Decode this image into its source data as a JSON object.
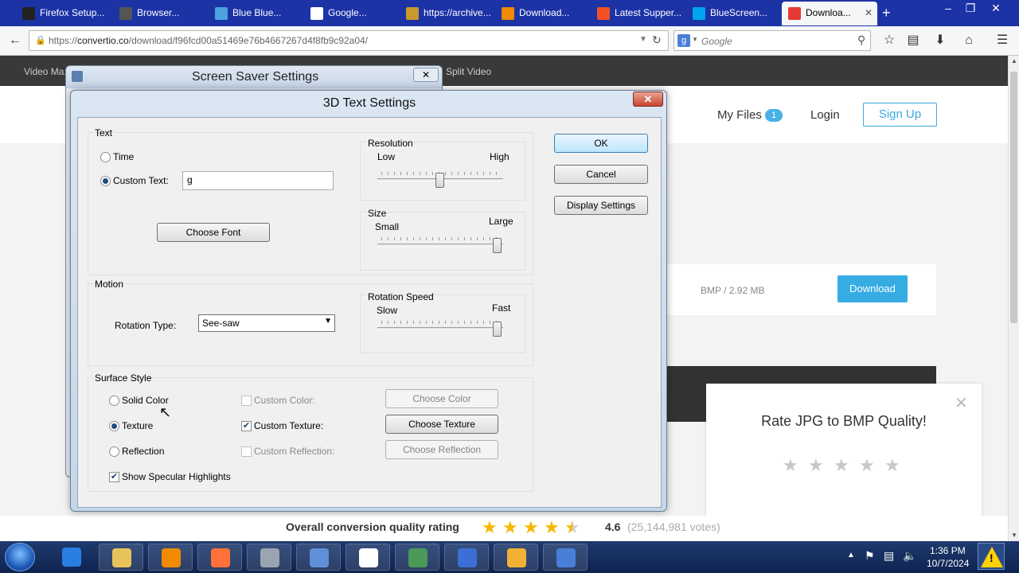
{
  "browser": {
    "tabs": [
      {
        "label": "Firefox Setup...",
        "icon": "film-icon",
        "color": "#222222"
      },
      {
        "label": "Browser...",
        "icon": "page-icon",
        "color": "#555555"
      },
      {
        "label": "Blue Blue...",
        "icon": "star-burst-icon",
        "color": "#4aa3df"
      },
      {
        "label": "Google...",
        "icon": "google-icon",
        "color": "#ffffff"
      },
      {
        "label": "https://archive...",
        "icon": "box-icon",
        "color": "#c79a2a"
      },
      {
        "label": "Download...",
        "icon": "vlc-cone-icon",
        "color": "#f08a00"
      },
      {
        "label": "Latest Supper...",
        "icon": "windows-flag-icon",
        "color": "#f25022"
      },
      {
        "label": "BlueScreen...",
        "icon": "windows-flag-icon",
        "color": "#00a4ef"
      },
      {
        "label": "Downloa...",
        "icon": "convertio-icon",
        "color": "#e53935",
        "active": true
      }
    ],
    "new_tab_symbol": "+",
    "url_prefix": "https://",
    "url_domain": "convertio.co",
    "url_path": "/download/f96fcd00a51469e76b4667267d4f8fb9c92a04/",
    "search_placeholder": "Google"
  },
  "site": {
    "nav_left": "Video Ma...",
    "nav_right": "Split Video",
    "my_files": "My Files",
    "my_files_count": "1",
    "login": "Login",
    "signup": "Sign Up",
    "file_meta": "BMP / 2.92 MB",
    "download": "Download",
    "rate_title": "Rate JPG to BMP Quality!",
    "rate_stars": 5,
    "overall_label": "Overall conversion quality rating",
    "overall_score": "4.6",
    "overall_votes": "(25,144,981 votes)",
    "overall_stars_filled": 4.5
  },
  "screensaver_dialog": {
    "title": "Screen Saver Settings"
  },
  "text3d_dialog": {
    "title": "3D Text Settings",
    "text_group": "Text",
    "time_label": "Time",
    "custom_text_label": "Custom Text:",
    "custom_text_value": "g",
    "choose_font": "Choose Font",
    "resolution_label": "Resolution",
    "resolution_low": "Low",
    "resolution_high": "High",
    "resolution_level": 0.5,
    "size_label": "Size",
    "size_small": "Small",
    "size_large": "Large",
    "size_level": 1.0,
    "motion_group": "Motion",
    "rotation_type_label": "Rotation Type:",
    "rotation_type_value": "See-saw",
    "rotation_speed_label": "Rotation Speed",
    "speed_slow": "Slow",
    "speed_fast": "Fast",
    "speed_level": 1.0,
    "surface_group": "Surface Style",
    "solid_color": "Solid Color",
    "texture": "Texture",
    "reflection": "Reflection",
    "custom_color": "Custom Color:",
    "custom_texture": "Custom Texture:",
    "custom_reflection": "Custom Reflection:",
    "choose_color": "Choose Color",
    "choose_texture": "Choose Texture",
    "choose_reflection": "Choose Reflection",
    "specular": "Show Specular Highlights",
    "ok": "OK",
    "cancel": "Cancel",
    "display_settings": "Display Settings"
  },
  "taskbar": {
    "time": "1:36 PM",
    "date": "10/7/2024",
    "apps": [
      "internet-explorer-icon",
      "file-explorer-icon",
      "media-player-icon",
      "firefox-icon",
      "drive-icon",
      "control-panel-icon",
      "panda-icon",
      "monitor-icon",
      "paint-icon",
      "globe-icon",
      "display-icon"
    ]
  }
}
